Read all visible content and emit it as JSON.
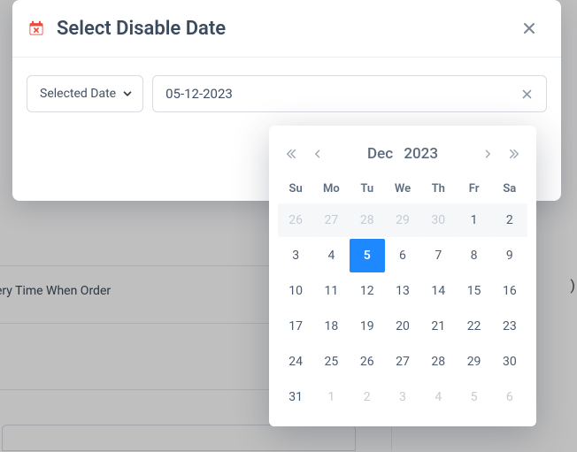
{
  "modal": {
    "title": "Select Disable Date",
    "close_aria": "Close"
  },
  "controls": {
    "mode_label": "Selected Date",
    "date_value": "05-12-2023"
  },
  "calendar": {
    "month_label": "Dec",
    "year_label": "2023",
    "dow": [
      "Su",
      "Mo",
      "Tu",
      "We",
      "Th",
      "Fr",
      "Sa"
    ],
    "weeks": [
      [
        {
          "n": 26,
          "out": true
        },
        {
          "n": 27,
          "out": true
        },
        {
          "n": 28,
          "out": true
        },
        {
          "n": 29,
          "out": true
        },
        {
          "n": 30,
          "out": true
        },
        {
          "n": 1,
          "out": false
        },
        {
          "n": 2,
          "out": false
        }
      ],
      [
        {
          "n": 3,
          "out": false
        },
        {
          "n": 4,
          "out": false
        },
        {
          "n": 5,
          "out": false,
          "sel": true
        },
        {
          "n": 6,
          "out": false
        },
        {
          "n": 7,
          "out": false
        },
        {
          "n": 8,
          "out": false
        },
        {
          "n": 9,
          "out": false
        }
      ],
      [
        {
          "n": 10,
          "out": false
        },
        {
          "n": 11,
          "out": false
        },
        {
          "n": 12,
          "out": false
        },
        {
          "n": 13,
          "out": false
        },
        {
          "n": 14,
          "out": false
        },
        {
          "n": 15,
          "out": false
        },
        {
          "n": 16,
          "out": false
        }
      ],
      [
        {
          "n": 17,
          "out": false
        },
        {
          "n": 18,
          "out": false
        },
        {
          "n": 19,
          "out": false
        },
        {
          "n": 20,
          "out": false
        },
        {
          "n": 21,
          "out": false
        },
        {
          "n": 22,
          "out": false
        },
        {
          "n": 23,
          "out": false
        }
      ],
      [
        {
          "n": 24,
          "out": false
        },
        {
          "n": 25,
          "out": false
        },
        {
          "n": 26,
          "out": false
        },
        {
          "n": 27,
          "out": false
        },
        {
          "n": 28,
          "out": false
        },
        {
          "n": 29,
          "out": false
        },
        {
          "n": 30,
          "out": false
        }
      ],
      [
        {
          "n": 31,
          "out": false
        },
        {
          "n": 1,
          "out": true
        },
        {
          "n": 2,
          "out": true
        },
        {
          "n": 3,
          "out": true
        },
        {
          "n": 4,
          "out": true
        },
        {
          "n": 5,
          "out": true
        },
        {
          "n": 6,
          "out": true
        }
      ]
    ]
  },
  "background": {
    "line1": "ery Time When Order",
    "paren": ")"
  }
}
